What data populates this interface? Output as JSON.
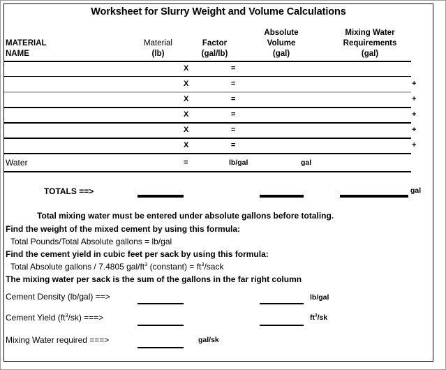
{
  "title": "Worksheet for Slurry Weight and Volume Calculations",
  "table": {
    "headers": {
      "material_name_line1": "MATERIAL",
      "material_name_line2": "NAME",
      "material_line1": "Material",
      "material_line2": "(lb)",
      "factor_line1": "Factor",
      "factor_line2": "(gal/lb)",
      "absolute_line1": "Absolute",
      "absolute_line2": "Volume",
      "absolute_line3": "(gal)",
      "mixing_line1": "Mixing Water",
      "mixing_line2": "Requirements",
      "mixing_line3": "(gal)"
    },
    "symbols": {
      "multiply": "X",
      "equals": "=",
      "plus": "+"
    },
    "rows": [
      {
        "name": "",
        "multiply": "X",
        "equals": "=",
        "plus": ""
      },
      {
        "name": "",
        "multiply": "X",
        "equals": "=",
        "plus": "+"
      },
      {
        "name": "",
        "multiply": "X",
        "equals": "=",
        "plus": "+"
      },
      {
        "name": "",
        "multiply": "X",
        "equals": "=",
        "plus": "+"
      },
      {
        "name": "",
        "multiply": "X",
        "equals": "=",
        "plus": "+"
      },
      {
        "name": "",
        "multiply": "X",
        "equals": "=",
        "plus": "+"
      }
    ],
    "water_row": {
      "name": "Water",
      "equals": "=",
      "unit_factor": "lb/gal",
      "unit_volume": "gal"
    },
    "totals": {
      "label": "TOTALS ==>",
      "unit_right": "gal"
    }
  },
  "notes": {
    "note_center": "Total mixing water must be entered under absolute gallons before totaling.",
    "line_weight_heading": "Find the weight of the mixed cement by using this formula:",
    "line_weight_formula": "Total Pounds/Total Absolute gallons = lb/gal",
    "line_yield_heading": "Find the cement yield in cubic feet per sack by using this formula:",
    "line_yield_formula_a": "Total Absolute gallons / 7.4805 gal/ft",
    "line_yield_formula_b": " (constant) = ft",
    "line_yield_formula_c": "/sack",
    "line_yield_sup": "3",
    "line_mixing_water": "The mixing water per sack is the sum of the gallons in the far right column"
  },
  "results": {
    "density_label": "Cement Density (lb/gal) ==>",
    "density_unit": "lb/gal",
    "yield_label_a": "Cement Yield (ft",
    "yield_label_b": "/sk) ===>",
    "yield_sup": "3",
    "yield_unit_a": "ft",
    "yield_unit_b": "/sk",
    "mixing_label": "Mixing Water required ===>",
    "mixing_unit": "gal/sk"
  }
}
